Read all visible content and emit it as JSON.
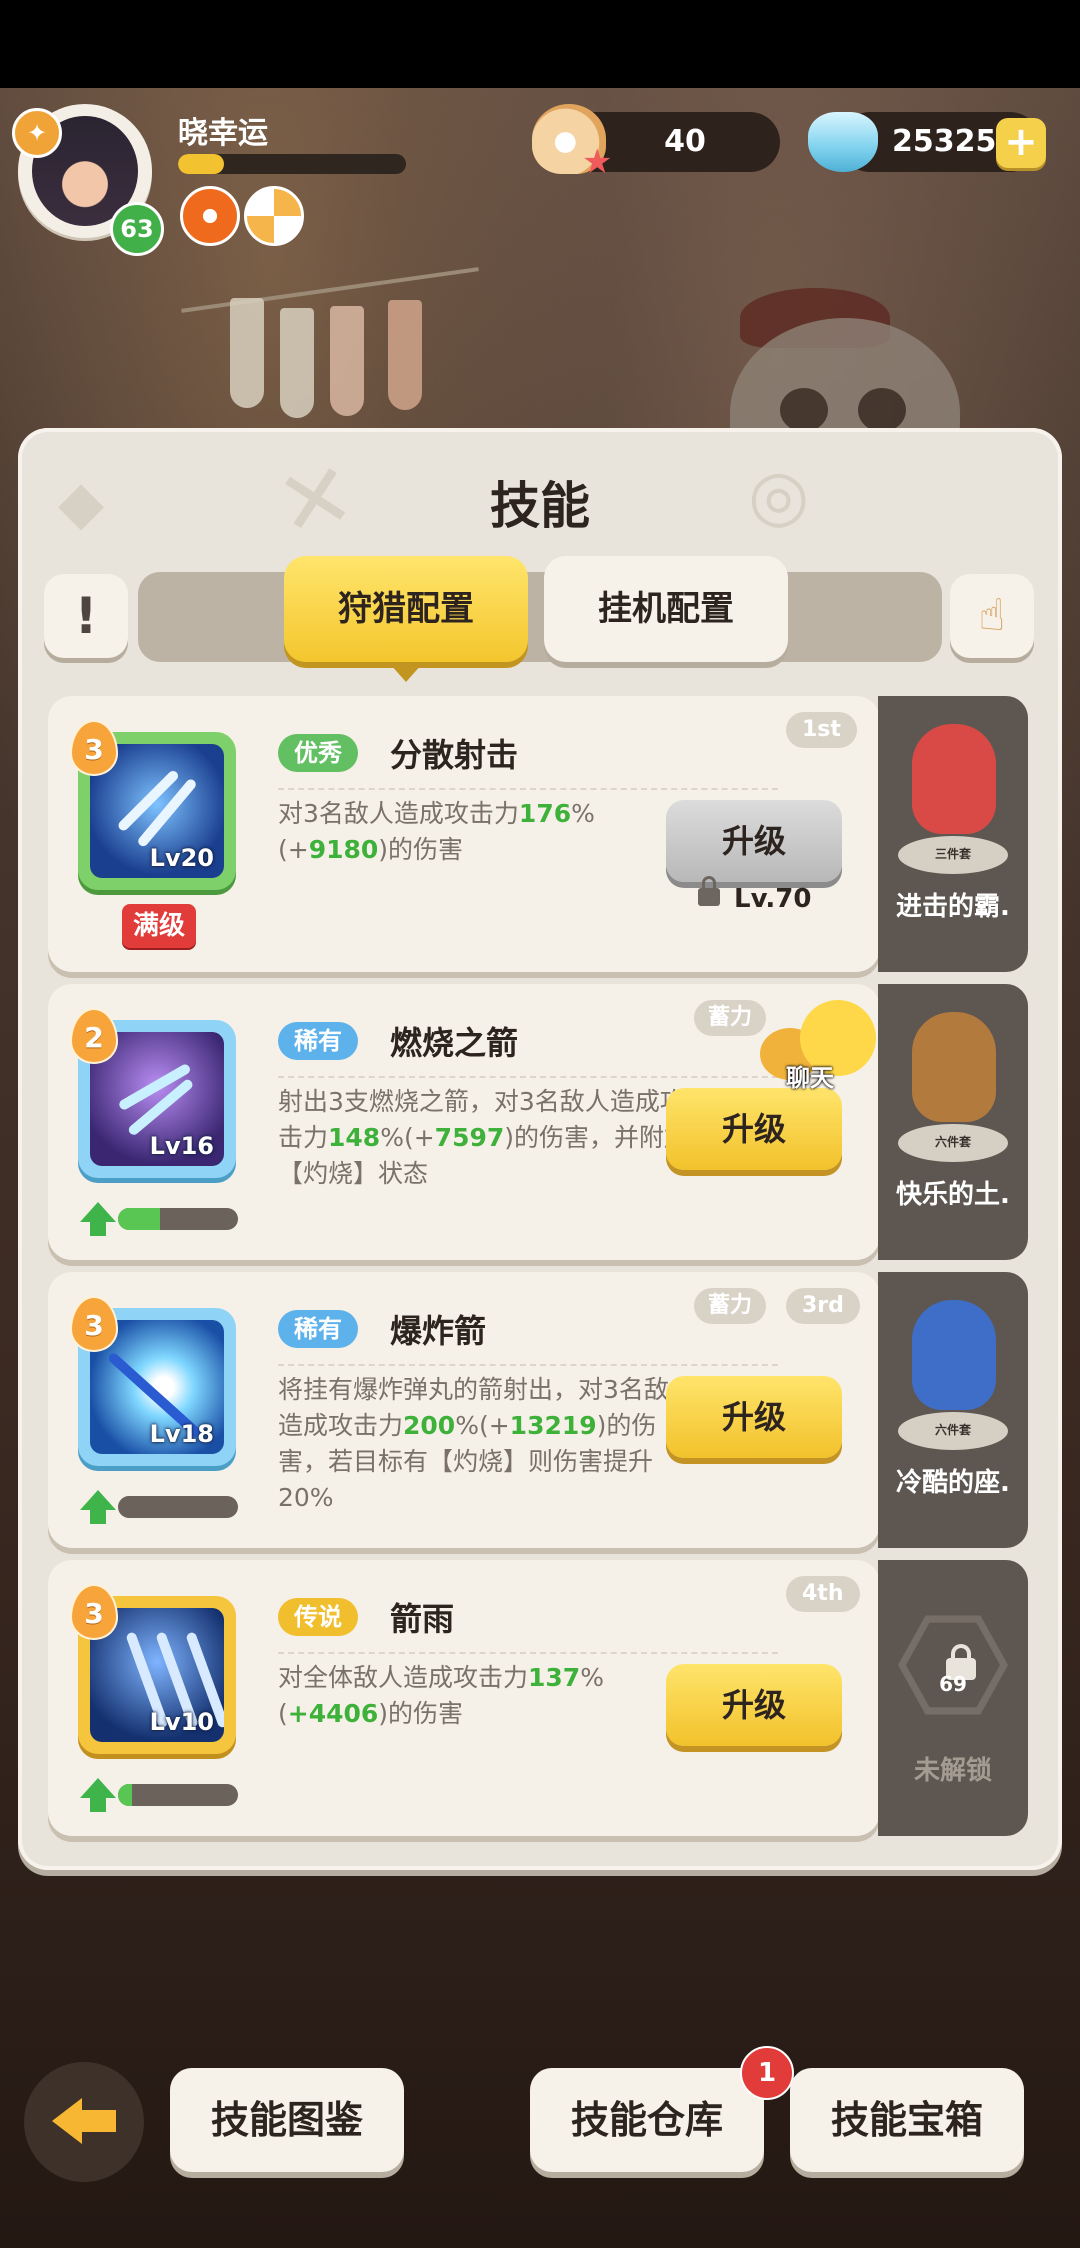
{
  "player": {
    "name": "晓幸运",
    "level": "63",
    "xp_fraction": 0.2
  },
  "resources": {
    "shells": "40",
    "gems": "25325",
    "plus": "+"
  },
  "panel": {
    "title": "技能",
    "info": "!",
    "tabs": [
      "狩猎配置",
      "挂机配置"
    ],
    "active_tab": 0
  },
  "skills": [
    {
      "rank": "1st",
      "stars": "3",
      "level_text": "Lv20",
      "rarity": "优秀",
      "name": "分散射击",
      "desc_parts": [
        "对3名敌人造成攻击力",
        "176",
        "%(+",
        "9180",
        ")的伤害"
      ],
      "maxed": "满级",
      "button": "升级",
      "req": "Lv.70",
      "charge": "",
      "side": {
        "label": "进击的霸.",
        "set": "三件套"
      }
    },
    {
      "rank": "",
      "stars": "2",
      "level_text": "Lv16",
      "rarity": "稀有",
      "name": "燃烧之箭",
      "desc_parts": [
        "射出3支燃烧之箭，对3名敌人造成攻击力",
        "148",
        "%(+",
        "7597",
        ")的伤害，并附加【灼烧】状态"
      ],
      "button": "升级",
      "charge": "蓄力",
      "progress": 0.35,
      "side": {
        "label": "快乐的土.",
        "set": "六件套"
      }
    },
    {
      "rank": "3rd",
      "stars": "3",
      "level_text": "Lv18",
      "rarity": "稀有",
      "name": "爆炸箭",
      "desc_parts": [
        "将挂有爆炸弹丸的箭射出，对3名敌人造成攻击力",
        "200",
        "%(+",
        "13219",
        ")的伤害，若目标有【灼烧】则伤害提升20%"
      ],
      "button": "升级",
      "charge": "蓄力",
      "progress": 0.0,
      "side": {
        "label": "冷酷的座.",
        "set": "六件套"
      }
    },
    {
      "rank": "4th",
      "stars": "3",
      "level_text": "Lv10",
      "rarity": "传说",
      "name": "箭雨",
      "desc_parts": [
        "对全体敌人造成攻击力",
        "137",
        "%(",
        "+4406",
        ")的伤害"
      ],
      "button": "升级",
      "charge": "",
      "progress": 0.12,
      "side": {
        "label": "未解锁",
        "lock_level": "69"
      }
    }
  ],
  "chat": "聊天",
  "bottom": {
    "handbook": "技能图鉴",
    "storage": "技能仓库",
    "storage_badge": "1",
    "chest": "技能宝箱"
  }
}
